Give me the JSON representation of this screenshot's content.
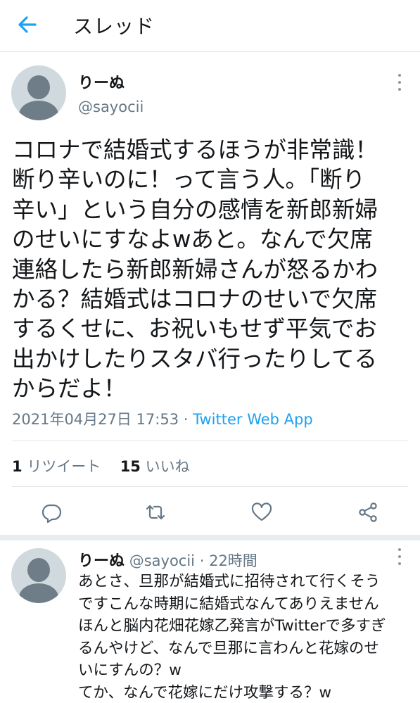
{
  "header": {
    "title": "スレッド",
    "back_icon": "arrow-left-icon",
    "accent": "#1da1f2"
  },
  "tweet": {
    "author_name": "りーぬ",
    "author_handle": "@sayocii",
    "text": "コロナで結婚式するほうが非常識！\n断り辛いのに！って言う人。「断り\n辛い」という自分の感情を新郎新婦\nのせいにすなよwあと。なんで欠席\n連絡したら新郎新婦さんが怒るかわ\nかる？結婚式はコロナのせいで欠席\nするくせに、お祝いもせず平気でお\n出かけしたりスタバ行ったりしてる\nからだよ！",
    "timestamp": "2021年04月27日 17:53",
    "separator": "·",
    "source_app": "Twitter Web App",
    "retweet_count": "1",
    "retweet_label": "リツイート",
    "like_count": "15",
    "like_label": "いいね"
  },
  "actions": [
    "reply-icon",
    "retweet-icon",
    "like-icon",
    "share-icon"
  ],
  "reply": {
    "author_name": "りーぬ",
    "author_handle": "@sayocii",
    "separator": "·",
    "time_ago": "22時間",
    "text": "あとさ、旦那が結婚式に招待されて行くそう\nですこんな時期に結婚式なんてありえません\nほんと脳内花畑花嫁乙発言がTwitterで多すぎ\nるんやけど、なんで旦那に言わんと花嫁のせ\nいにすんの？w\nてか、なんで花嫁にだけ攻撃する？w\nほんま女の意地悪いとこ出とるよ"
  }
}
